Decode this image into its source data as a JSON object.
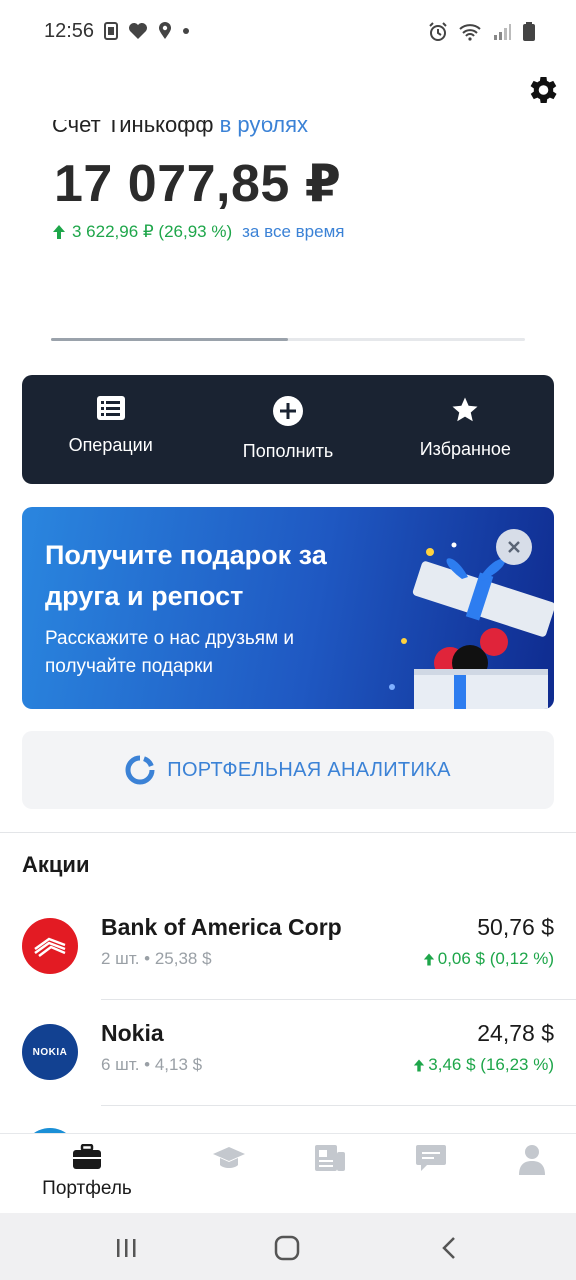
{
  "status_bar": {
    "time": "12:56",
    "left_icons": [
      "sim-card-icon",
      "heart-icon",
      "location-pin-icon",
      "dot-icon"
    ],
    "right_icons": [
      "alarm-icon",
      "wifi-icon",
      "signal-icon",
      "battery-icon"
    ]
  },
  "account": {
    "name_prefix": "Счет Тинькофф ",
    "currency_label": "в рублях",
    "balance": "17 077,85 ₽",
    "gain_value": "3 622,96 ₽ (26,93 %)",
    "gain_period": "за все время"
  },
  "carousel": {
    "progress_fraction": 0.5
  },
  "actions": [
    {
      "label": "Операции",
      "icon": "list-icon"
    },
    {
      "label": "Пополнить",
      "icon": "plus-circle-icon"
    },
    {
      "label": "Избранное",
      "icon": "star-icon"
    }
  ],
  "promo": {
    "title": "Получите подарок за друга и репост",
    "description": "Расскажите о нас друзьям и получайте подарки"
  },
  "analytics": {
    "label": "ПОРТФЕЛЬНАЯ АНАЛИТИКА"
  },
  "stocks_section": {
    "title": "Акции",
    "items": [
      {
        "name": "Bank of America Corp",
        "sub": "2 шт. • 25,38 $",
        "price": "50,76 $",
        "change": "0,06 $ (0,12 %)",
        "logo_color": "#e31b23",
        "logo_text": ""
      },
      {
        "name": "Nokia",
        "sub": "6 шт. • 4,13 $",
        "price": "24,78 $",
        "change": "3,46 $ (16,23 %)",
        "logo_color": "#124191",
        "logo_text": "NOKIA"
      }
    ]
  },
  "tabbar": {
    "active_label": "Портфель",
    "tabs": [
      "briefcase-icon",
      "graduation-cap-icon",
      "news-icon",
      "chat-icon",
      "profile-icon"
    ]
  },
  "colors": {
    "accent": "#3b82d6",
    "positive": "#1ea64a",
    "dark_panel": "#1a2332"
  }
}
